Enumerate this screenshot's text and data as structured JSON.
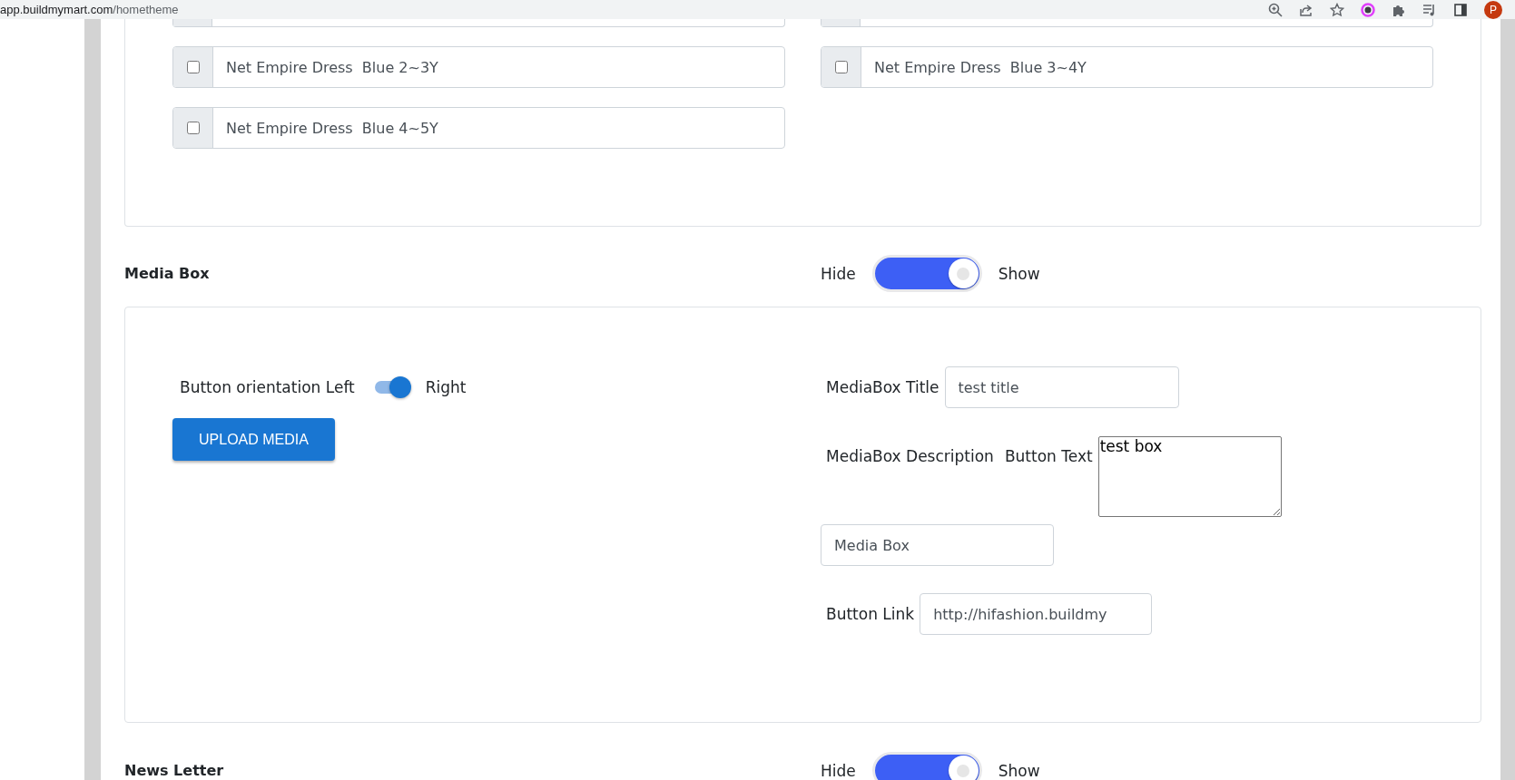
{
  "browser": {
    "url_host": "app.buildmymart.com",
    "url_path": "/hometheme",
    "avatar": "P"
  },
  "product_options": [
    {
      "label": "Net Empire Dress  Blue 2~3Y",
      "checked": false
    },
    {
      "label": "Net Empire Dress  Blue 3~4Y",
      "checked": false
    },
    {
      "label": "Net Empire Dress  Blue 4~5Y",
      "checked": false
    }
  ],
  "media_section": {
    "title": "Media Box",
    "hide_label": "Hide",
    "show_label": "Show",
    "on": true
  },
  "media_box": {
    "orientation_label": "Button orientation Left",
    "orientation_right": "Right",
    "orientation_on": true,
    "upload_button": "UPLOAD MEDIA",
    "title_label": "MediaBox Title",
    "title_value": "test title",
    "description_label": "MediaBox Description",
    "button_text_label": "Button Text",
    "description_value": "test box",
    "button_text_value": "Media Box",
    "link_label": "Button Link",
    "link_value": "http://hifashion.buildmy"
  },
  "newsletter_section": {
    "title": "News Letter",
    "hide_label": "Hide",
    "show_label": "Show",
    "on": true
  }
}
